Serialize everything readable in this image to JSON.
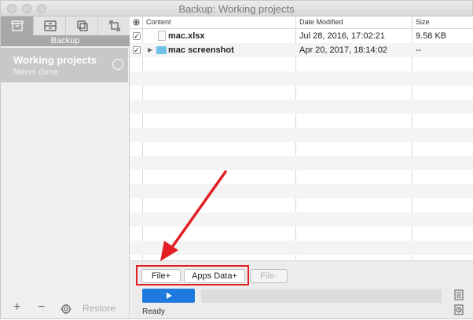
{
  "window": {
    "title": "Backup: Working projects"
  },
  "sidebar": {
    "active_tab_label": "Backup",
    "tabs": [
      {
        "name": "backup-tab",
        "icon": "archive-icon"
      },
      {
        "name": "sync-tab",
        "icon": "drawer-icon"
      },
      {
        "name": "clone-tab",
        "icon": "copy-icon"
      },
      {
        "name": "transfer-tab",
        "icon": "transfer-icon"
      }
    ],
    "project": {
      "name": "Working projects",
      "status": "Never done"
    },
    "bottom": {
      "add": "+",
      "remove": "−",
      "restore_label": "Restore"
    }
  },
  "table": {
    "columns": {
      "content": "Content",
      "date": "Date Modified",
      "size": "Size"
    },
    "rows": [
      {
        "checked": true,
        "name": "mac.xlsx",
        "date": "Jul 28, 2016, 17:02:21",
        "size": "9.58 KB",
        "type": "file"
      },
      {
        "checked": true,
        "name": "mac screenshot",
        "date": "Apr 20, 2017, 18:14:02",
        "size": "--",
        "type": "folder"
      }
    ]
  },
  "controls": {
    "file_add": "File+",
    "apps_data_add": "Apps Data+",
    "file_remove": "File-",
    "status": "Ready"
  },
  "colors": {
    "accent_blue": "#1f7ae0",
    "highlight_red": "#e21f26",
    "folder_blue": "#6fc1ea"
  }
}
